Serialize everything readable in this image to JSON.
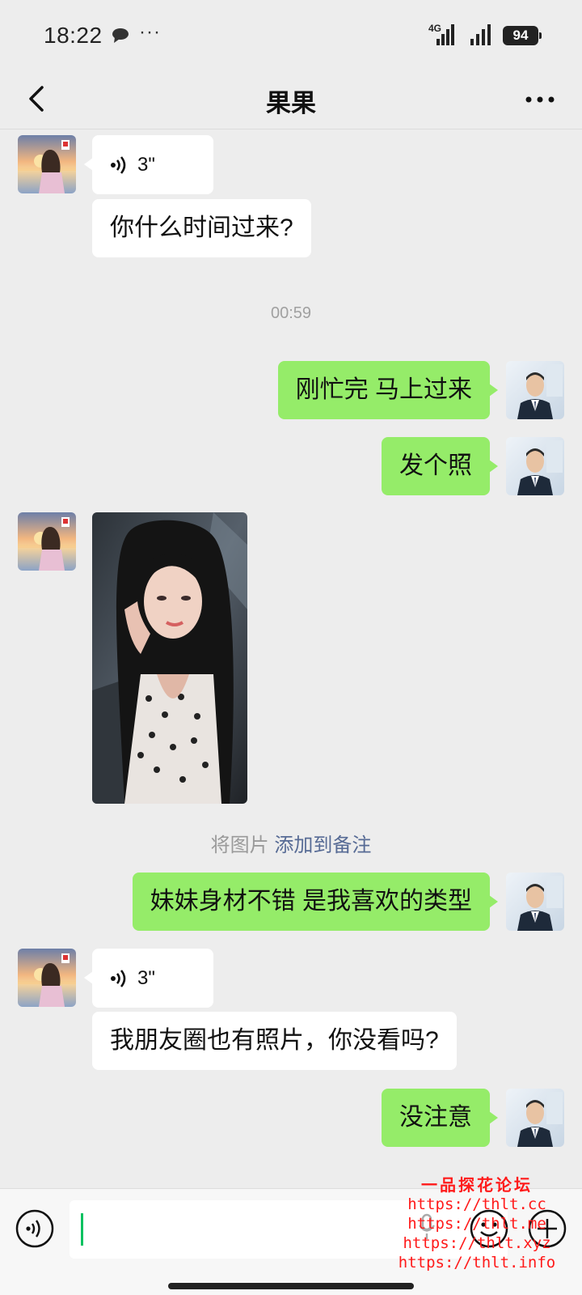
{
  "status_bar": {
    "time": "18:22",
    "more": "···",
    "network": "4G",
    "battery": "94"
  },
  "header": {
    "title": "果果"
  },
  "messages": [
    {
      "side": "in",
      "type": "voice",
      "duration": "3\""
    },
    {
      "side": "in",
      "type": "text",
      "text": "你什么时间过来?"
    },
    {
      "type": "timestamp",
      "text": "00:59"
    },
    {
      "side": "out",
      "type": "text",
      "text": "刚忙完 马上过来"
    },
    {
      "side": "out",
      "type": "text",
      "text": "发个照"
    },
    {
      "side": "in",
      "type": "image"
    },
    {
      "type": "system",
      "text": "将图片",
      "link": "添加到备注"
    },
    {
      "side": "out",
      "type": "text",
      "text": "妹妹身材不错 是我喜欢的类型"
    },
    {
      "side": "in",
      "type": "voice",
      "duration": "3\""
    },
    {
      "side": "in",
      "type": "text",
      "text": "我朋友圈也有照片，你没看吗?"
    },
    {
      "side": "out",
      "type": "text",
      "text": "没注意"
    }
  ],
  "input": {
    "value": ""
  },
  "watermark": {
    "title": "一品探花论坛",
    "lines": [
      "https://thlt.cc",
      "https://thlt.me",
      "https://thlt.xyz",
      "https://thlt.info"
    ]
  },
  "colors": {
    "background": "#ededed",
    "outgoing_bubble": "#95ec69",
    "incoming_bubble": "#ffffff",
    "link": "#576b95",
    "cursor": "#07c160"
  }
}
